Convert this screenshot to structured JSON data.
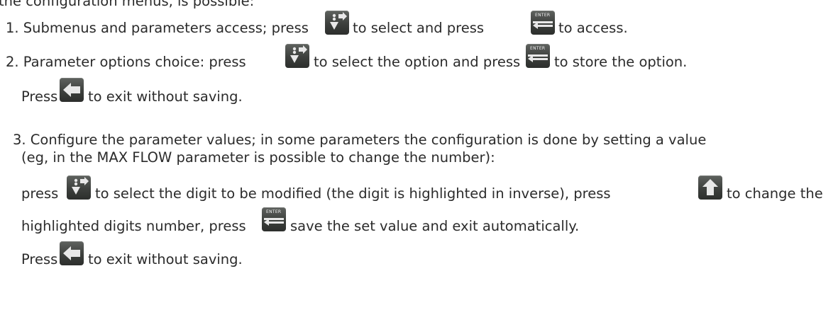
{
  "intro": "the configuration menus, is possible:",
  "item1": {
    "a": "1. Submenus and parameters access; press",
    "b": "to select and press",
    "c": "to access."
  },
  "item2": {
    "a": "2. Parameter options choice: press",
    "b": "to select the option and press",
    "c": "to store the option.",
    "d": "Press",
    "e": "to exit without saving."
  },
  "item3": {
    "line1": "3. Configure the parameter values; in some parameters the configuration is done by setting a value",
    "line2": "(eg, in the MAX FLOW parameter is possible to change the number):",
    "p1": "press",
    "p2": "to select the digit to be modified (the digit is highlighted in inverse), press",
    "p3": "to change the",
    "q1": "highlighted digits number, press",
    "q2": "save the set value and exit automatically.",
    "r1": "Press",
    "r2": "to exit without saving."
  },
  "keys": {
    "enter_label": "ENTER",
    "icons": [
      "select-arrows-icon",
      "enter-icon",
      "back-arrow-icon",
      "up-arrow-icon"
    ]
  }
}
